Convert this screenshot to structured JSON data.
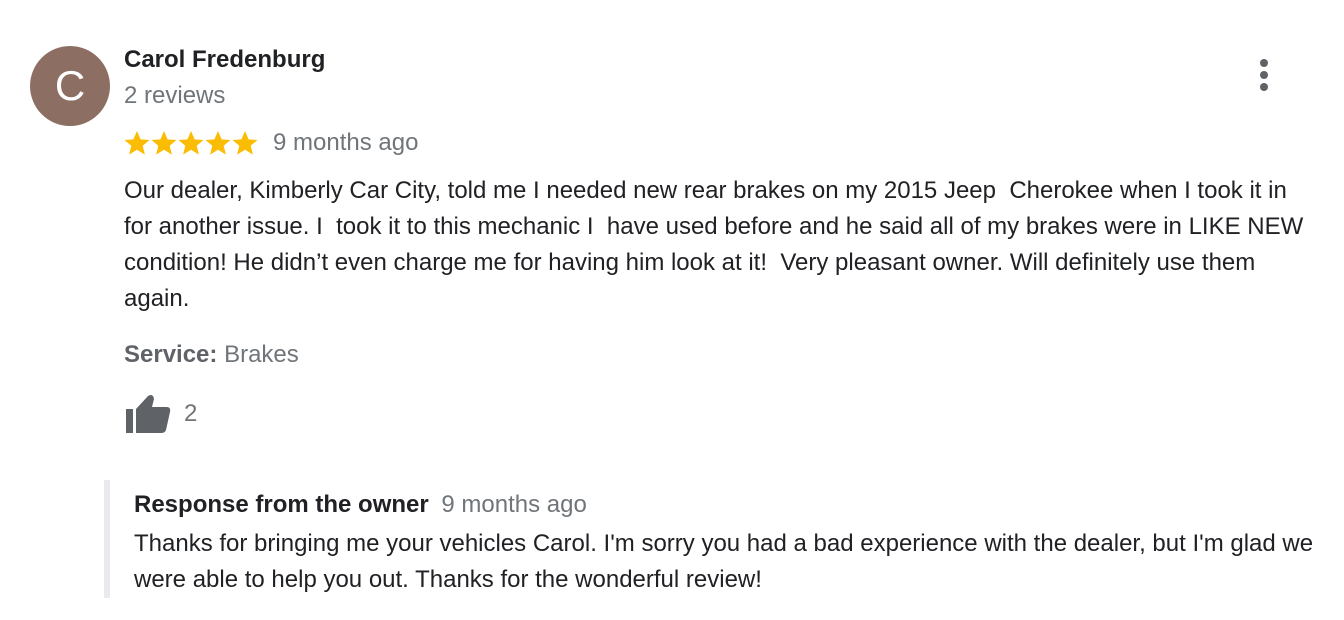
{
  "reviewer": {
    "initial": "C",
    "avatar_color": "#8d6e63",
    "name": "Carol Fredenburg",
    "meta": "2 reviews"
  },
  "review": {
    "rating": 5,
    "rating_max": 5,
    "star_color": "#fbbc04",
    "date": "9 months ago",
    "text": "Our dealer, Kimberly Car City, told me I needed new rear brakes on my 2015 Jeep  Cherokee when I took it in for another issue. I  took it to this mechanic I  have used before and he said all of my brakes were in LIKE NEW condition! He didn’t even charge me for having him look at it!  Very pleasant owner. Will definitely use them again.",
    "service_label": "Service:",
    "service_value": "Brakes",
    "like_icon": "thumb-up-icon",
    "like_count": "2",
    "menu_icon": "more-vert-icon"
  },
  "owner_response": {
    "title": "Response from the owner",
    "date": "9 months ago",
    "text": "Thanks for bringing me your vehicles Carol. I'm sorry you had a bad experience with the dealer, but I'm glad we were able to help you out. Thanks for the wonderful review!"
  }
}
